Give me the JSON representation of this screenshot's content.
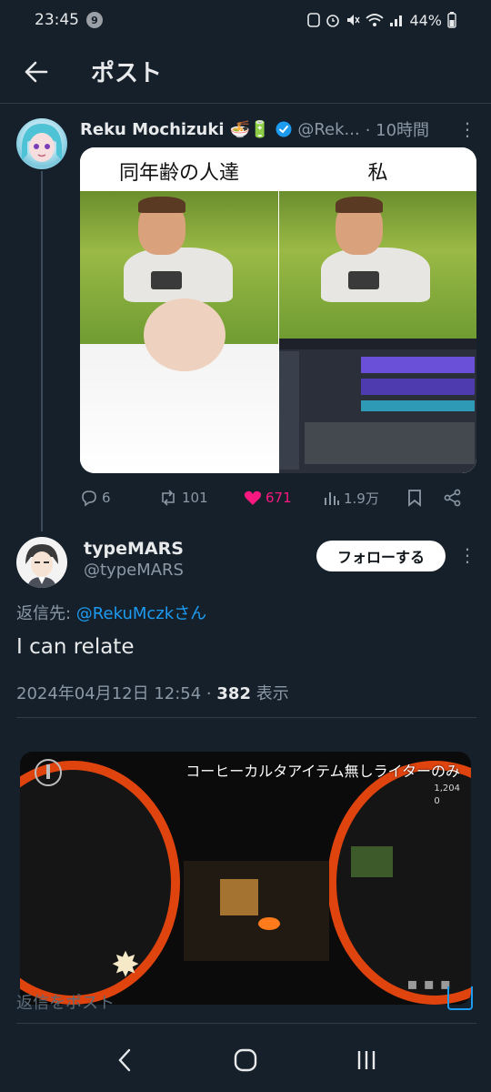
{
  "status_bar": {
    "time": "23:45",
    "notification_count": "9",
    "battery": "44%"
  },
  "header": {
    "title": "ポスト"
  },
  "post": {
    "author_name": "Reku Mochizuki",
    "author_emoji": "🍜🔋",
    "handle": "@Rek...",
    "time": "· 10時間",
    "meme": {
      "left_caption": "同年齢の人達",
      "right_caption": "私"
    },
    "stats": {
      "replies": "6",
      "reposts": "101",
      "likes": "671",
      "views": "1.9万"
    }
  },
  "reply": {
    "author_name": "typeMARS",
    "handle": "@typeMARS",
    "follow_label": "フォローする",
    "reply_to_prefix": "返信先: ",
    "reply_to_mention": "@RekuMczkさん",
    "text": "I can relate",
    "date": "2024年04月12日 12:54 · ",
    "views": "382",
    "views_suffix": " 表示"
  },
  "video": {
    "caption": "コーヒーカルタアイテム無しライターのみ",
    "hud_count": "1,204",
    "hud_zero": "0"
  },
  "compose": {
    "placeholder": "返信をポスト"
  }
}
